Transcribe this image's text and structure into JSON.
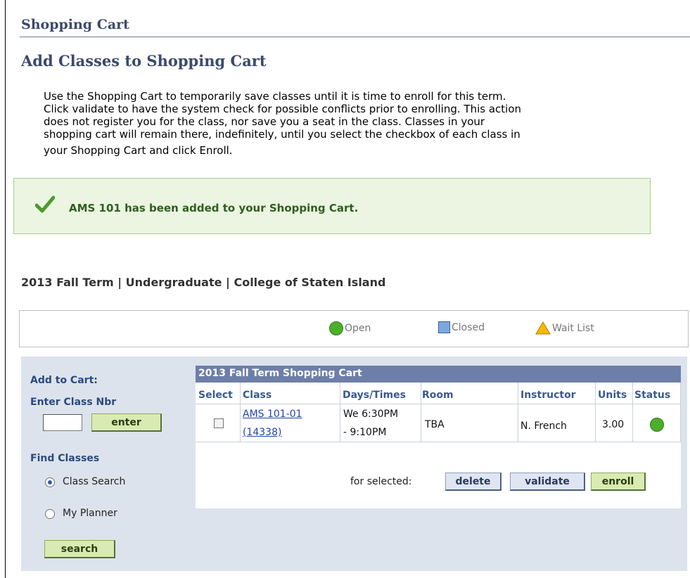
{
  "header": {
    "section_title": "Shopping Cart",
    "page_title": "Add Classes to Shopping Cart"
  },
  "intro": {
    "lines": [
      "Use the Shopping Cart to temporarily save classes until it is time to enroll for this term.",
      "Click validate to have the system check for possible conflicts prior to enrolling. This action",
      "does not register you for the class, nor save you a seat in the class. Classes in your",
      "shopping cart will remain there, indefinitely, until you select the checkbox of each class in",
      "your Shopping Cart and click Enroll."
    ]
  },
  "message": {
    "text": "AMS  101 has been added to your Shopping Cart.",
    "icon": "checkmark-icon",
    "color": "#2f5e1f"
  },
  "term": "2013 Fall Term | Undergraduate | College of Staten Island",
  "legend": {
    "open": "Open",
    "closed": "Closed",
    "wait_list": "Wait List"
  },
  "sidebar": {
    "add_to_cart_label": "Add to Cart:",
    "enter_class_nbr_label": "Enter Class Nbr",
    "class_nbr_value": "",
    "enter_button": "enter",
    "find_classes_label": "Find Classes",
    "radio_options": [
      {
        "label": "Class Search",
        "selected": true
      },
      {
        "label": "My Planner",
        "selected": false
      }
    ],
    "search_button": "search"
  },
  "cart": {
    "title": "2013 Fall Term Shopping Cart",
    "columns": [
      "Select",
      "Class",
      "Days/Times",
      "Room",
      "Instructor",
      "Units",
      "Status"
    ],
    "rows": [
      {
        "selected": false,
        "class_line1": "AMS 101-01",
        "class_line2": "(14338)",
        "days_line1": "We 6:30PM",
        "days_line2": "- 9:10PM",
        "room": "TBA",
        "instructor": "N. French",
        "units": "3.00",
        "status": "Open"
      }
    ],
    "for_selected_label": "for selected:",
    "buttons": {
      "delete": "delete",
      "validate": "validate",
      "enroll": "enroll"
    }
  },
  "colors": {
    "title": "#3b4a6b",
    "accent_blue": "#2b4a7f",
    "cart_header": "#6d7fa8",
    "open_green": "#4caf2a",
    "closed_blue": "#7ea7de",
    "waitlist_yellow": "#f5b800"
  }
}
